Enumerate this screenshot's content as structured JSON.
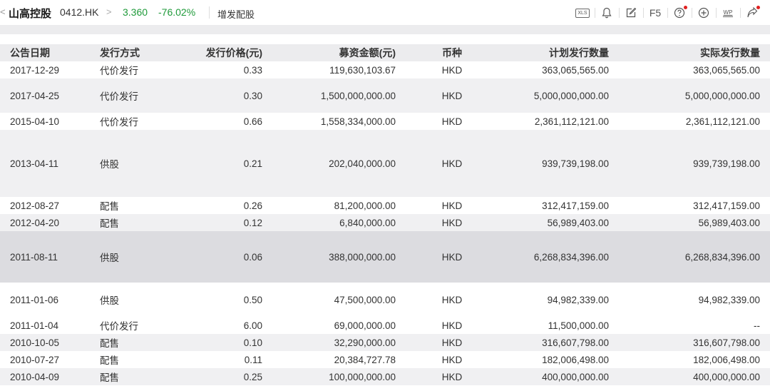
{
  "header": {
    "back_glyph": "<",
    "stock_name": "山高控股",
    "stock_code": "0412.HK",
    "chevron": ">",
    "price": "3.360",
    "change": "-76.02%",
    "page_label": "增发配股"
  },
  "toolbar": {
    "xls_label": "XLS",
    "f5_label": "F5",
    "wp_label": "WP"
  },
  "table": {
    "columns": [
      "公告日期",
      "发行方式",
      "发行价格(元)",
      "募资金额(元)",
      "币种",
      "计划发行数量",
      "实际发行数量"
    ],
    "rows": [
      {
        "date": "2017-12-29",
        "method": "代价发行",
        "price": "0.33",
        "amount": "119,630,103.67",
        "currency": "HKD",
        "planned": "363,065,565.00",
        "actual": "363,065,565.00"
      },
      {
        "date": "2017-04-25",
        "method": "代价发行",
        "price": "0.30",
        "amount": "1,500,000,000.00",
        "currency": "HKD",
        "planned": "5,000,000,000.00",
        "actual": "5,000,000,000.00"
      },
      {
        "date": "2015-04-10",
        "method": "代价发行",
        "price": "0.66",
        "amount": "1,558,334,000.00",
        "currency": "HKD",
        "planned": "2,361,112,121.00",
        "actual": "2,361,112,121.00"
      },
      {
        "date": "2013-04-11",
        "method": "供股",
        "price": "0.21",
        "amount": "202,040,000.00",
        "currency": "HKD",
        "planned": "939,739,198.00",
        "actual": "939,739,198.00"
      },
      {
        "date": "2012-08-27",
        "method": "配售",
        "price": "0.26",
        "amount": "81,200,000.00",
        "currency": "HKD",
        "planned": "312,417,159.00",
        "actual": "312,417,159.00"
      },
      {
        "date": "2012-04-20",
        "method": "配售",
        "price": "0.12",
        "amount": "6,840,000.00",
        "currency": "HKD",
        "planned": "56,989,403.00",
        "actual": "56,989,403.00"
      },
      {
        "date": "2011-08-11",
        "method": "供股",
        "price": "0.06",
        "amount": "388,000,000.00",
        "currency": "HKD",
        "planned": "6,268,834,396.00",
        "actual": "6,268,834,396.00"
      },
      {
        "date": "2011-01-06",
        "method": "供股",
        "price": "0.50",
        "amount": "47,500,000.00",
        "currency": "HKD",
        "planned": "94,982,339.00",
        "actual": "94,982,339.00"
      },
      {
        "date": "2011-01-04",
        "method": "代价发行",
        "price": "6.00",
        "amount": "69,000,000.00",
        "currency": "HKD",
        "planned": "11,500,000.00",
        "actual": "--"
      },
      {
        "date": "2010-10-05",
        "method": "配售",
        "price": "0.10",
        "amount": "32,290,000.00",
        "currency": "HKD",
        "planned": "316,607,798.00",
        "actual": "316,607,798.00"
      },
      {
        "date": "2010-07-27",
        "method": "配售",
        "price": "0.11",
        "amount": "20,384,727.78",
        "currency": "HKD",
        "planned": "182,006,498.00",
        "actual": "182,006,498.00"
      },
      {
        "date": "2010-04-09",
        "method": "配售",
        "price": "0.25",
        "amount": "100,000,000.00",
        "currency": "HKD",
        "planned": "400,000,000.00",
        "actual": "400,000,000.00"
      }
    ]
  },
  "colors": {
    "positive_green": "#1f9a3a",
    "header_bg": "#ececee",
    "alt_row_bg": "#f0f0f2",
    "highlight_row_bg": "#dcdce0",
    "notify_dot": "#e02020"
  }
}
